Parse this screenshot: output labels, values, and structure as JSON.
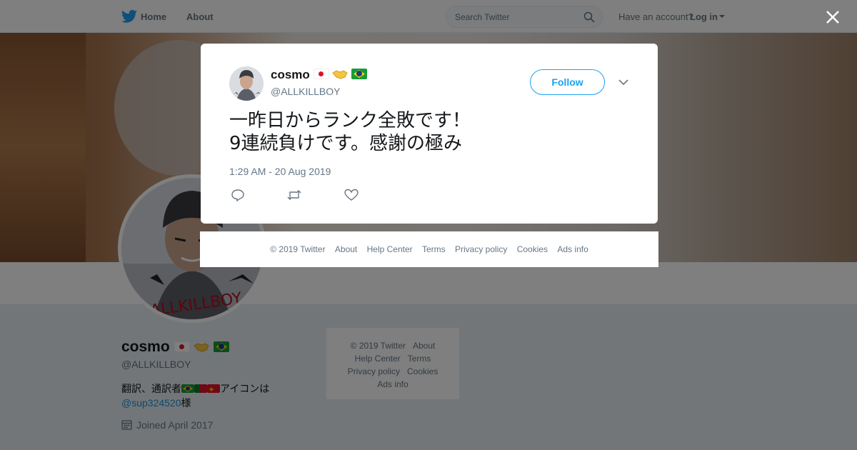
{
  "topbar": {
    "home_label": "Home",
    "about_label": "About",
    "search_placeholder": "Search Twitter",
    "have_account": "Have an account?",
    "login_label": "Log in"
  },
  "profile": {
    "name": "cosmo",
    "handle": "@ALLKILLBOY",
    "bio_text": "翻訳、通訳者",
    "bio_after_flags": "アイコンは",
    "bio_mention": "@sup324520",
    "bio_suffix": "様",
    "joined": "Joined April 2017",
    "name_icons": [
      "jp-flag-icon",
      "handshake-icon",
      "brazil-flag-icon"
    ],
    "bio_icons": [
      "brazil-flag-icon",
      "portugal-flag-icon",
      "china-flag-icon"
    ]
  },
  "side_footer": {
    "copyright": "© 2019 Twitter",
    "about": "About",
    "help_center": "Help Center",
    "terms": "Terms",
    "privacy": "Privacy policy",
    "cookies": "Cookies",
    "ads_info": "Ads info"
  },
  "tweet": {
    "name": "cosmo",
    "handle": "@ALLKILLBOY",
    "follow_label": "Follow",
    "text_line1": "一昨日からランク全敗です！",
    "text_line2": "9連続負けです。感謝の極み",
    "timestamp": "1:29 AM - 20 Aug 2019",
    "actions": [
      "reply-icon",
      "retweet-icon",
      "like-icon"
    ]
  },
  "modal_footer": {
    "copyright": "© 2019 Twitter",
    "about": "About",
    "help_center": "Help Center",
    "terms": "Terms",
    "privacy": "Privacy policy",
    "cookies": "Cookies",
    "ads_info": "Ads info"
  },
  "colors": {
    "accent": "#1da1f2",
    "link": "#1b95e0",
    "text_secondary": "#657786",
    "overlay": "rgba(0,0,0,0.5)"
  }
}
